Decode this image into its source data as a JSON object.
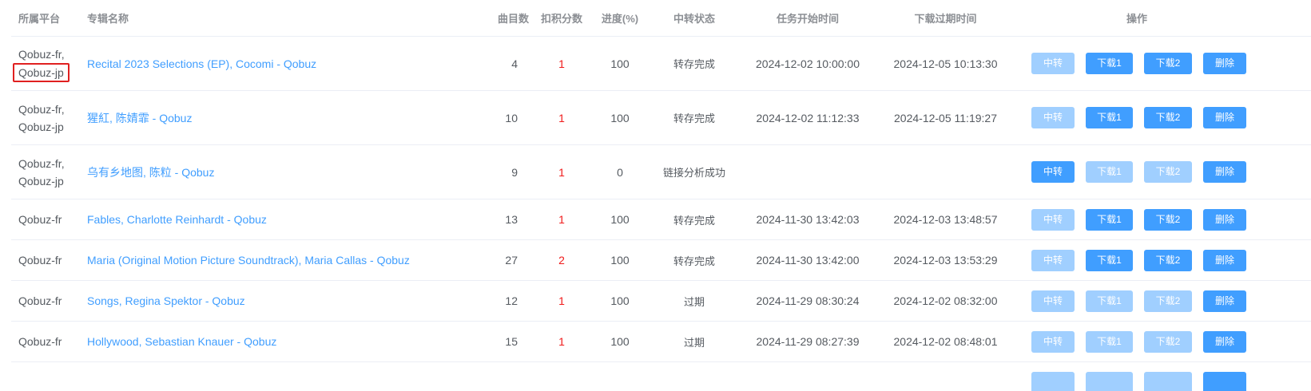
{
  "headers": {
    "platform": "所属平台",
    "album": "专辑名称",
    "tracks": "曲目数",
    "credits": "扣积分数",
    "progress": "进度(%)",
    "status": "中转状态",
    "start_time": "任务开始时间",
    "expire_time": "下载过期时间",
    "actions": "操作"
  },
  "buttons": {
    "relay": "中转",
    "download1": "下载1",
    "download2": "下载2",
    "delete": "删除"
  },
  "colors": {
    "accent": "#409eff",
    "accent_disabled": "#a0cfff",
    "credits": "#f01b1b",
    "highlight_box": "#e02020"
  },
  "rows": [
    {
      "platforms": [
        "Qobuz-fr,",
        "Qobuz-jp"
      ],
      "highlighted_platform_index": 1,
      "album": "Recital 2023 Selections (EP), Cocomi - Qobuz",
      "tracks": "4",
      "credits": "1",
      "progress": "100",
      "status": "转存完成",
      "start_time": "2024-12-02 10:00:00",
      "expire_time": "2024-12-05 10:13:30",
      "relay_enabled": false,
      "dl1_enabled": true,
      "dl2_enabled": true
    },
    {
      "platforms": [
        "Qobuz-fr,",
        "Qobuz-jp"
      ],
      "album": "猩紅, 陈婧霏 - Qobuz",
      "tracks": "10",
      "credits": "1",
      "progress": "100",
      "status": "转存完成",
      "start_time": "2024-12-02 11:12:33",
      "expire_time": "2024-12-05 11:19:27",
      "relay_enabled": false,
      "dl1_enabled": true,
      "dl2_enabled": true
    },
    {
      "platforms": [
        "Qobuz-fr,",
        "Qobuz-jp"
      ],
      "album": "乌有乡地图, 陈粒 - Qobuz",
      "tracks": "9",
      "credits": "1",
      "progress": "0",
      "status": "链接分析成功",
      "start_time": "",
      "expire_time": "",
      "relay_enabled": true,
      "dl1_enabled": false,
      "dl2_enabled": false
    },
    {
      "platforms": [
        "Qobuz-fr"
      ],
      "album": "Fables, Charlotte Reinhardt - Qobuz",
      "tracks": "13",
      "credits": "1",
      "progress": "100",
      "status": "转存完成",
      "start_time": "2024-11-30 13:42:03",
      "expire_time": "2024-12-03 13:48:57",
      "relay_enabled": false,
      "dl1_enabled": true,
      "dl2_enabled": true
    },
    {
      "platforms": [
        "Qobuz-fr"
      ],
      "album": "Maria (Original Motion Picture Soundtrack), Maria Callas - Qobuz",
      "tracks": "27",
      "credits": "2",
      "progress": "100",
      "status": "转存完成",
      "start_time": "2024-11-30 13:42:00",
      "expire_time": "2024-12-03 13:53:29",
      "relay_enabled": false,
      "dl1_enabled": true,
      "dl2_enabled": true
    },
    {
      "platforms": [
        "Qobuz-fr"
      ],
      "album": "Songs, Regina Spektor - Qobuz",
      "tracks": "12",
      "credits": "1",
      "progress": "100",
      "status": "过期",
      "start_time": "2024-11-29 08:30:24",
      "expire_time": "2024-12-02 08:32:00",
      "relay_enabled": false,
      "dl1_enabled": false,
      "dl2_enabled": false
    },
    {
      "platforms": [
        "Qobuz-fr"
      ],
      "album": "Hollywood, Sebastian Knauer - Qobuz",
      "tracks": "15",
      "credits": "1",
      "progress": "100",
      "status": "过期",
      "start_time": "2024-11-29 08:27:39",
      "expire_time": "2024-12-02 08:48:01",
      "relay_enabled": false,
      "dl1_enabled": false,
      "dl2_enabled": false
    }
  ]
}
